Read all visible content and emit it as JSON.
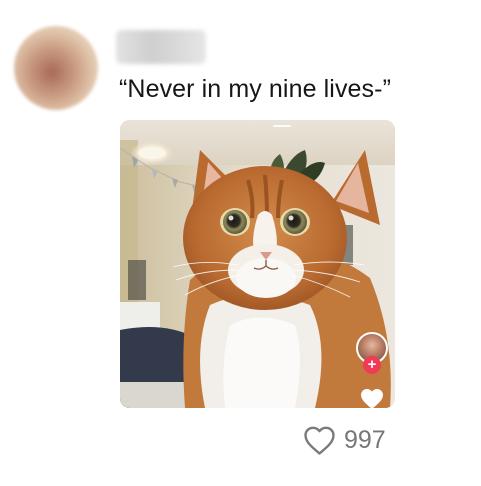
{
  "comment": {
    "username": "",
    "text": "“Never in my nine lives-”",
    "avatar_icon": "user-avatar-blurred"
  },
  "media": {
    "type": "video-thumbnail",
    "subject": "orange and white cat",
    "creator_avatar_icon": "creator-avatar",
    "follow_icon": "plus-icon",
    "follow_color": "#ef3b55",
    "like_icon": "heart-filled-icon"
  },
  "likes": {
    "icon": "heart-outline-icon",
    "count": "997",
    "count_color": "#777777"
  }
}
